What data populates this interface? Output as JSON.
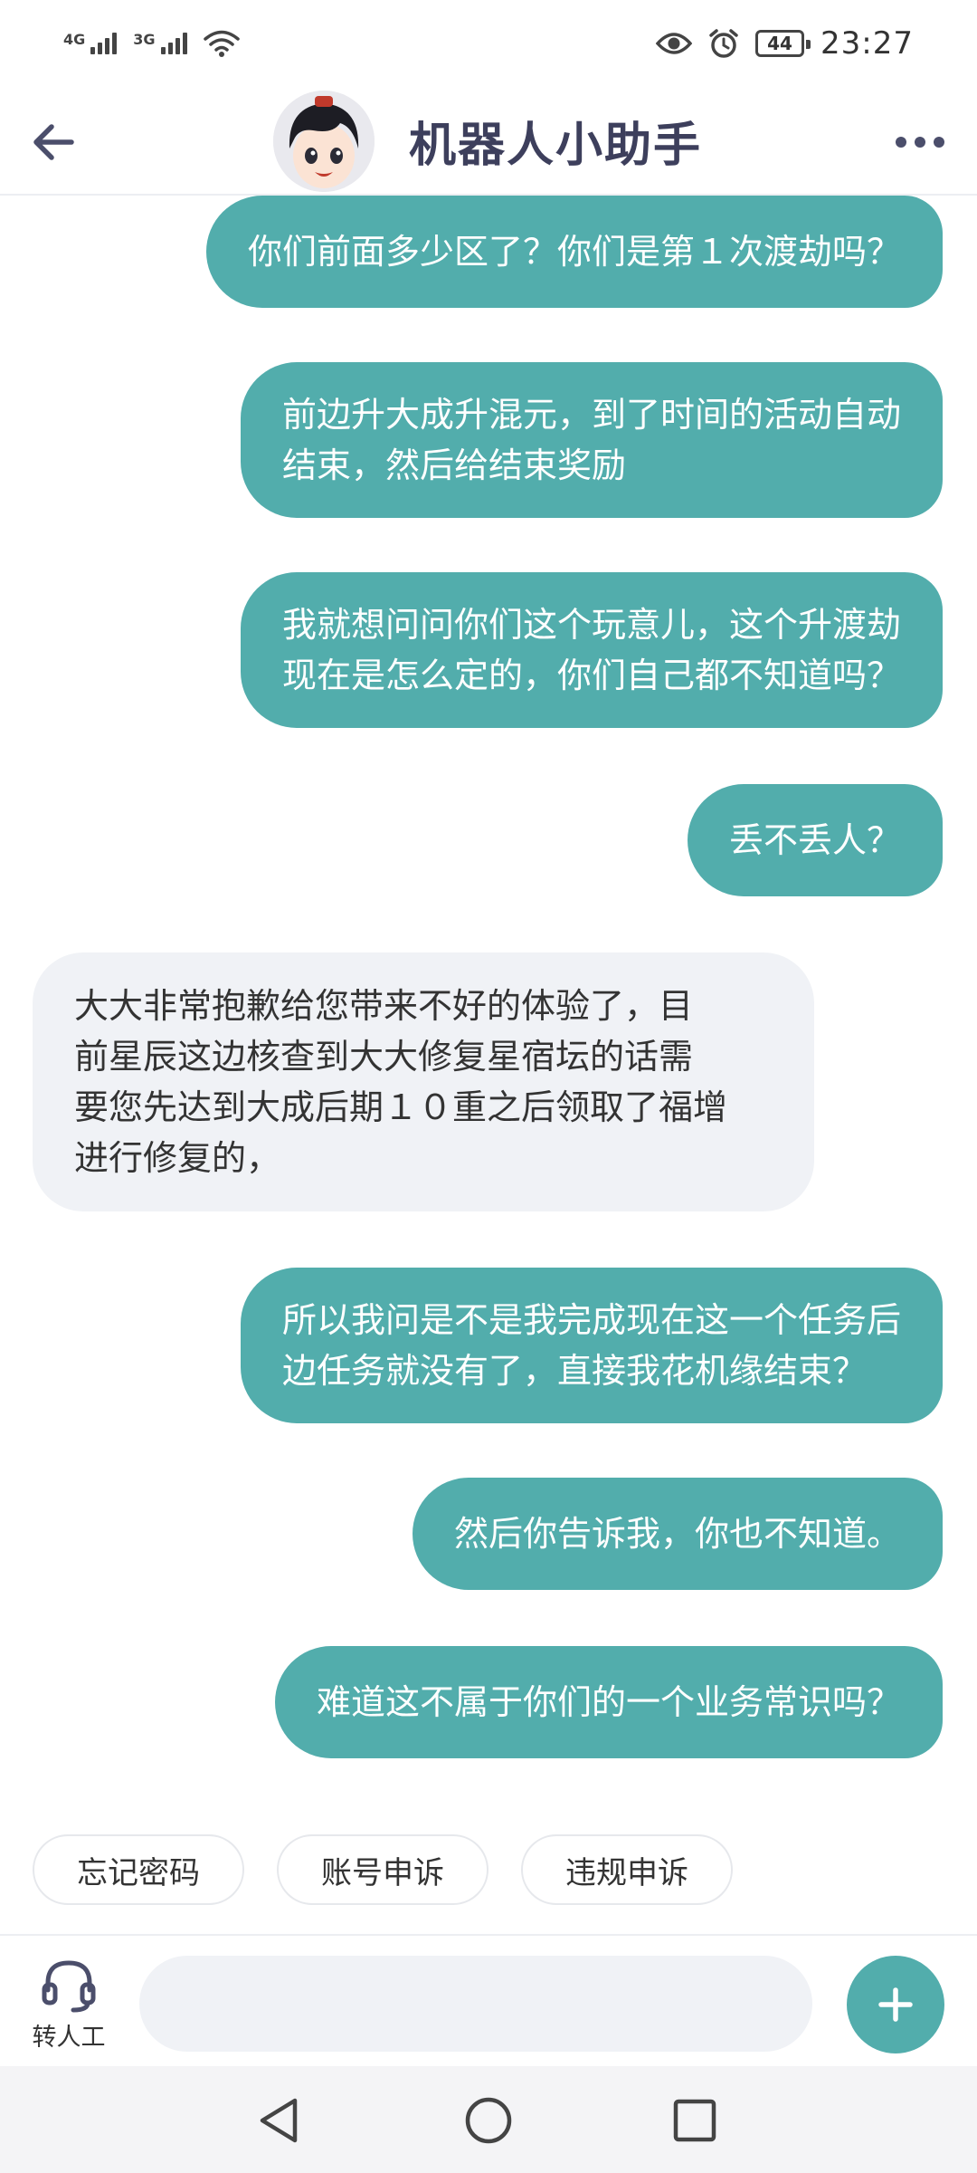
{
  "status_bar": {
    "network_1": "4G",
    "network_2": "3G",
    "battery": "44",
    "time": "23:27"
  },
  "header": {
    "title": "机器人小助手",
    "back_icon": "arrow-left-icon",
    "more_icon": "more-dots-icon"
  },
  "messages": [
    {
      "from": "user",
      "lines": [
        "你们前面多少区了？你们是第１次渡劫吗？"
      ]
    },
    {
      "from": "user",
      "lines": [
        "前边升大成升混元，到了时间的活动自动",
        "结束，然后给结束奖励"
      ]
    },
    {
      "from": "user",
      "lines": [
        "我就想问问你们这个玩意儿，这个升渡劫",
        "现在是怎么定的，你们自己都不知道吗？"
      ]
    },
    {
      "from": "user",
      "lines": [
        "丢不丢人？"
      ]
    },
    {
      "from": "bot",
      "lines": [
        "大大非常抱歉给您带来不好的体验了，目",
        "前星辰这边核查到大大修复星宿坛的话需",
        "要您先达到大成后期１０重之后领取了福增",
        "进行修复的，"
      ]
    },
    {
      "from": "user",
      "lines": [
        "所以我问是不是我完成现在这一个任务后",
        "边任务就没有了，直接我花机缘结束？"
      ]
    },
    {
      "from": "user",
      "lines": [
        "然后你告诉我，你也不知道。"
      ]
    },
    {
      "from": "user",
      "lines": [
        "难道这不属于你们的一个业务常识吗？"
      ]
    }
  ],
  "quick_replies": [
    "忘记密码",
    "账号申诉",
    "违规申诉"
  ],
  "input_bar": {
    "human_label": "转人工",
    "human_icon": "headset-icon",
    "placeholder": "",
    "plus_icon": "plus-icon"
  },
  "colors": {
    "user_bubble": "#52adac",
    "bot_bubble": "#f0f2f6",
    "title": "#3d3f5c"
  }
}
